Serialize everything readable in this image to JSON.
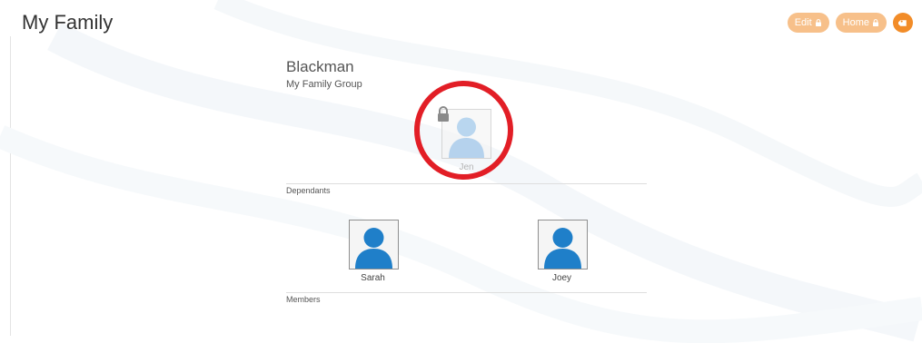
{
  "page": {
    "title": "My Family"
  },
  "header_actions": {
    "edit_label": "Edit",
    "home_label": "Home",
    "accent_color": "#f28c28",
    "pill_color": "#f7c08a"
  },
  "family": {
    "name": "Blackman",
    "group_label": "My Family Group",
    "primary_member": {
      "name": "Jen",
      "locked": true
    }
  },
  "sections": {
    "dependants_label": "Dependants",
    "members_label": "Members"
  },
  "dependants": [
    {
      "name": "Sarah"
    },
    {
      "name": "Joey"
    }
  ],
  "annotation": {
    "color": "#e21e26"
  }
}
